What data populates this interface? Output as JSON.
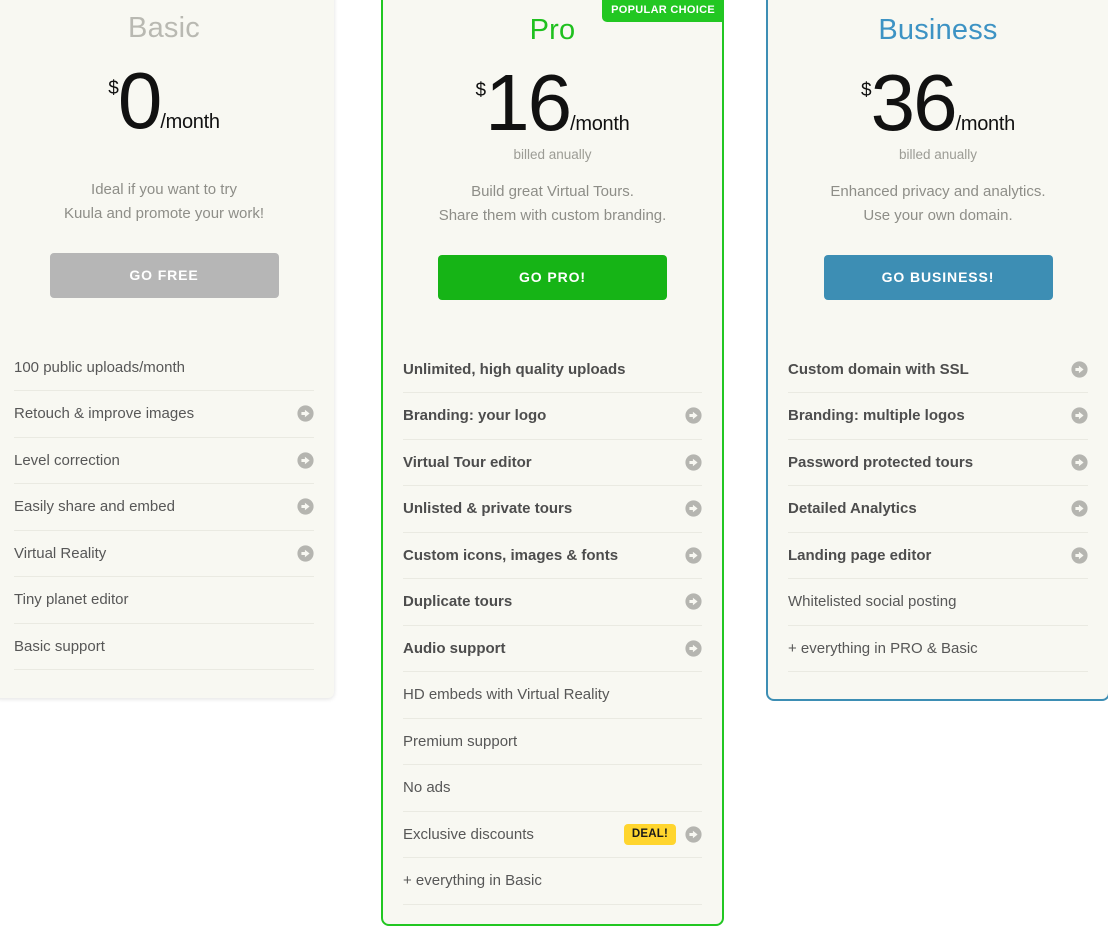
{
  "plans": [
    {
      "id": "basic",
      "name": "Basic",
      "currency": "$",
      "amount": "0",
      "period": "/month",
      "billed": "",
      "description_lines": [
        "Ideal if you want to try",
        "Kuula and promote your work!"
      ],
      "cta_label": "GO FREE",
      "accent": "#b6b6b6",
      "features": [
        {
          "label": "100 public uploads/month",
          "bold": false,
          "arrow": false,
          "badge": null
        },
        {
          "label": "Retouch & improve images",
          "bold": false,
          "arrow": true,
          "badge": null
        },
        {
          "label": "Level correction",
          "bold": false,
          "arrow": true,
          "badge": null
        },
        {
          "label": "Easily share and embed",
          "bold": false,
          "arrow": true,
          "badge": null
        },
        {
          "label": "Virtual Reality",
          "bold": false,
          "arrow": true,
          "badge": null
        },
        {
          "label": "Tiny planet editor",
          "bold": false,
          "arrow": false,
          "badge": null
        },
        {
          "label": "Basic support",
          "bold": false,
          "arrow": false,
          "badge": null
        }
      ]
    },
    {
      "id": "pro",
      "name": "Pro",
      "ribbon": "POPULAR CHOICE",
      "currency": "$",
      "amount": "16",
      "period": "/month",
      "billed": "billed anually",
      "description_lines": [
        "Build great Virtual Tours.",
        "Share them with custom branding."
      ],
      "cta_label": "GO PRO!",
      "accent": "#22c722",
      "features": [
        {
          "label": "Unlimited, high quality uploads",
          "bold": true,
          "arrow": false,
          "badge": null
        },
        {
          "label": "Branding: your logo",
          "bold": true,
          "arrow": true,
          "badge": null
        },
        {
          "label": "Virtual Tour editor",
          "bold": true,
          "arrow": true,
          "badge": null
        },
        {
          "label": "Unlisted & private tours",
          "bold": true,
          "arrow": true,
          "badge": null
        },
        {
          "label": "Custom icons, images & fonts",
          "bold": true,
          "arrow": true,
          "badge": null
        },
        {
          "label": "Duplicate tours",
          "bold": true,
          "arrow": true,
          "badge": null
        },
        {
          "label": "Audio support",
          "bold": true,
          "arrow": true,
          "badge": null
        },
        {
          "label": "HD embeds with Virtual Reality",
          "bold": false,
          "arrow": false,
          "badge": null
        },
        {
          "label": "Premium support",
          "bold": false,
          "arrow": false,
          "badge": null
        },
        {
          "label": "No ads",
          "bold": false,
          "arrow": false,
          "badge": null
        },
        {
          "label": "Exclusive discounts",
          "bold": false,
          "arrow": true,
          "badge": "DEAL!"
        },
        {
          "label": "+ everything in Basic",
          "bold": false,
          "arrow": false,
          "badge": null
        }
      ]
    },
    {
      "id": "business",
      "name": "Business",
      "currency": "$",
      "amount": "36",
      "period": "/month",
      "billed": "billed anually",
      "description_lines": [
        "Enhanced privacy and analytics.",
        "Use your own domain."
      ],
      "cta_label": "GO BUSINESS!",
      "accent": "#3d8eb4",
      "features": [
        {
          "label": "Custom domain with SSL",
          "bold": true,
          "arrow": true,
          "badge": null
        },
        {
          "label": "Branding: multiple logos",
          "bold": true,
          "arrow": true,
          "badge": null
        },
        {
          "label": "Password protected tours",
          "bold": true,
          "arrow": true,
          "badge": null
        },
        {
          "label": "Detailed Analytics",
          "bold": true,
          "arrow": true,
          "badge": null
        },
        {
          "label": "Landing page editor",
          "bold": true,
          "arrow": true,
          "badge": null
        },
        {
          "label": "Whitelisted social posting",
          "bold": false,
          "arrow": false,
          "badge": null
        },
        {
          "label": "+ everything in PRO & Basic",
          "bold": false,
          "arrow": false,
          "badge": null
        }
      ]
    }
  ],
  "icons": {
    "arrow_circle": "arrow-circle-right-icon",
    "arrow_fill": "#b5b5b0"
  }
}
